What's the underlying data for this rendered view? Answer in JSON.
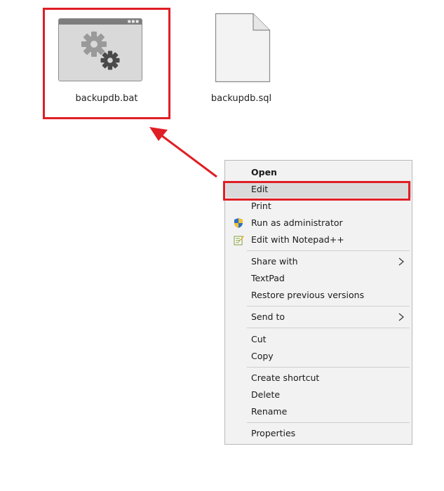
{
  "desktop": {
    "files": [
      {
        "name": "backupdb.bat",
        "icon": "batch-file-gears-icon"
      },
      {
        "name": "backupdb.sql",
        "icon": "blank-document-icon"
      }
    ]
  },
  "context_menu": {
    "items": [
      {
        "label": "Open",
        "bold": true
      },
      {
        "label": "Edit",
        "highlighted": true
      },
      {
        "label": "Print"
      },
      {
        "label": "Run as administrator",
        "icon": "uac-shield-icon"
      },
      {
        "label": "Edit with Notepad++",
        "icon": "notepad-plus-plus-icon"
      },
      {
        "label": "Share with",
        "submenu": true
      },
      {
        "label": "TextPad"
      },
      {
        "label": "Restore previous versions"
      },
      {
        "label": "Send to",
        "submenu": true
      },
      {
        "label": "Cut"
      },
      {
        "label": "Copy"
      },
      {
        "label": "Create shortcut"
      },
      {
        "label": "Delete"
      },
      {
        "label": "Rename"
      },
      {
        "label": "Properties"
      }
    ]
  },
  "annotation": {
    "color": "#e01e25"
  }
}
